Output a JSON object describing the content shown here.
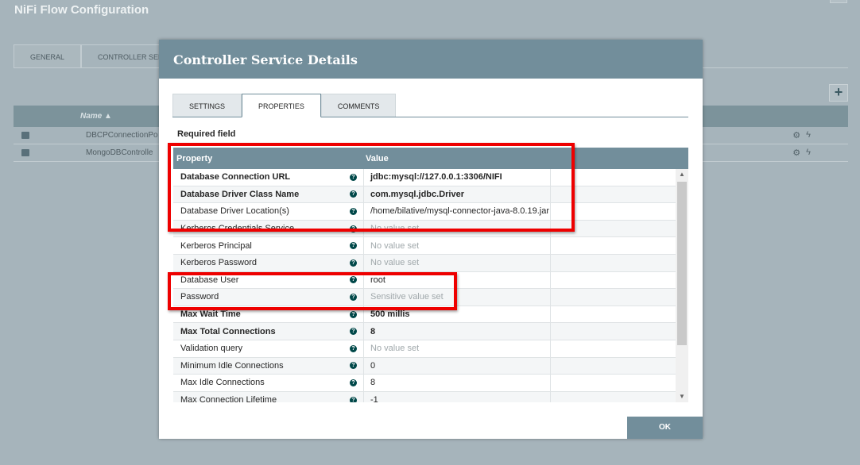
{
  "background": {
    "title": "NiFi Flow Configuration",
    "tabs": [
      "GENERAL",
      "CONTROLLER SERV"
    ],
    "add_label": "+",
    "table": {
      "name_header": "Name ▲",
      "rows": [
        "DBCPConnectionPo",
        "MongoDBControlle"
      ]
    }
  },
  "dialog": {
    "title": "Controller Service Details",
    "tabs": [
      "SETTINGS",
      "PROPERTIES",
      "COMMENTS"
    ],
    "active_tab": "PROPERTIES",
    "required_label": "Required field",
    "grid": {
      "headers": {
        "property": "Property",
        "value": "Value"
      },
      "rows": [
        {
          "name": "Database Connection URL",
          "value": "jdbc:mysql://127.0.0.1:3306/NIFI",
          "required": true,
          "set": true
        },
        {
          "name": "Database Driver Class Name",
          "value": "com.mysql.jdbc.Driver",
          "required": true,
          "set": true
        },
        {
          "name": "Database Driver Location(s)",
          "value": "/home/bilative/mysql-connector-java-8.0.19.jar",
          "required": false,
          "set": true
        },
        {
          "name": "Kerberos Credentials Service",
          "value": "No value set",
          "required": false,
          "set": false
        },
        {
          "name": "Kerberos Principal",
          "value": "No value set",
          "required": false,
          "set": false
        },
        {
          "name": "Kerberos Password",
          "value": "No value set",
          "required": false,
          "set": false
        },
        {
          "name": "Database User",
          "value": "root",
          "required": false,
          "set": true
        },
        {
          "name": "Password",
          "value": "Sensitive value set",
          "required": false,
          "set": false
        },
        {
          "name": "Max Wait Time",
          "value": "500 millis",
          "required": true,
          "set": true
        },
        {
          "name": "Max Total Connections",
          "value": "8",
          "required": true,
          "set": true
        },
        {
          "name": "Validation query",
          "value": "No value set",
          "required": false,
          "set": false
        },
        {
          "name": "Minimum Idle Connections",
          "value": "0",
          "required": false,
          "set": true
        },
        {
          "name": "Max Idle Connections",
          "value": "8",
          "required": false,
          "set": true
        },
        {
          "name": "Max Connection Lifetime",
          "value": "-1",
          "required": false,
          "set": true
        }
      ]
    },
    "ok_label": "OK"
  },
  "colors": {
    "accent": "#728e9b",
    "highlight": "#ee0000",
    "help_icon": "#004849"
  }
}
